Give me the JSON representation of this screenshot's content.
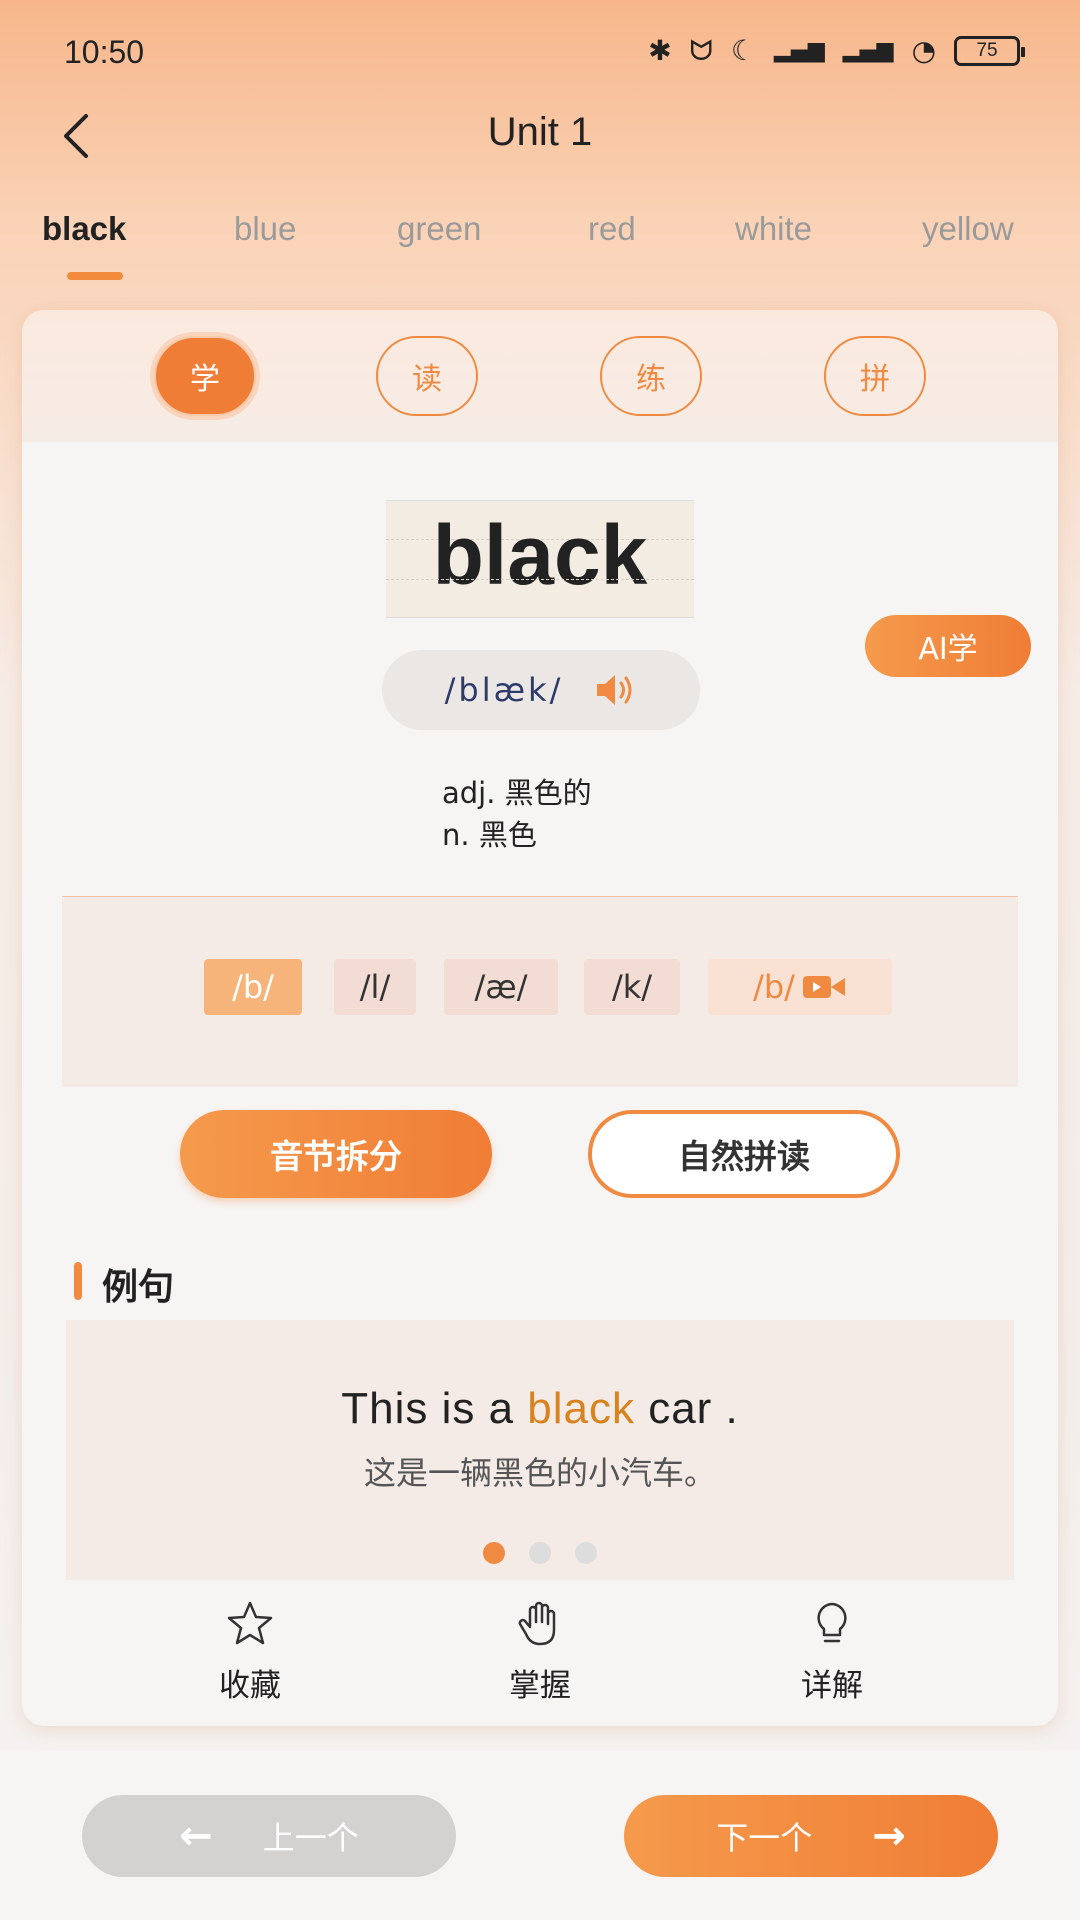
{
  "status": {
    "time": "10:50",
    "battery": "75"
  },
  "header": {
    "title": "Unit 1"
  },
  "tabs": [
    "black",
    "blue",
    "green",
    "red",
    "white",
    "yellow"
  ],
  "modes": [
    "学",
    "读",
    "练",
    "拼"
  ],
  "word": {
    "text": "black",
    "phonetic": "/blæk/",
    "meanings": [
      "adj. 黑色的",
      "n. 黑色"
    ]
  },
  "ai_button": "AI学",
  "phonemes": [
    "/b/",
    "/l/",
    "/æ/",
    "/k/"
  ],
  "phoneme_video": "/b/",
  "buttons": {
    "split": "音节拆分",
    "natural": "自然拼读"
  },
  "example": {
    "section_title": "例句",
    "en_before": "This is a ",
    "en_keyword": "black",
    "en_after": " car .",
    "zh": "这是一辆黑色的小汽车。"
  },
  "actions": {
    "favorite": "收藏",
    "master": "掌握",
    "detail": "详解"
  },
  "nav": {
    "prev": "上一个",
    "next": "下一个"
  },
  "colors": {
    "accent": "#f08a40",
    "keyword": "#d98320"
  }
}
